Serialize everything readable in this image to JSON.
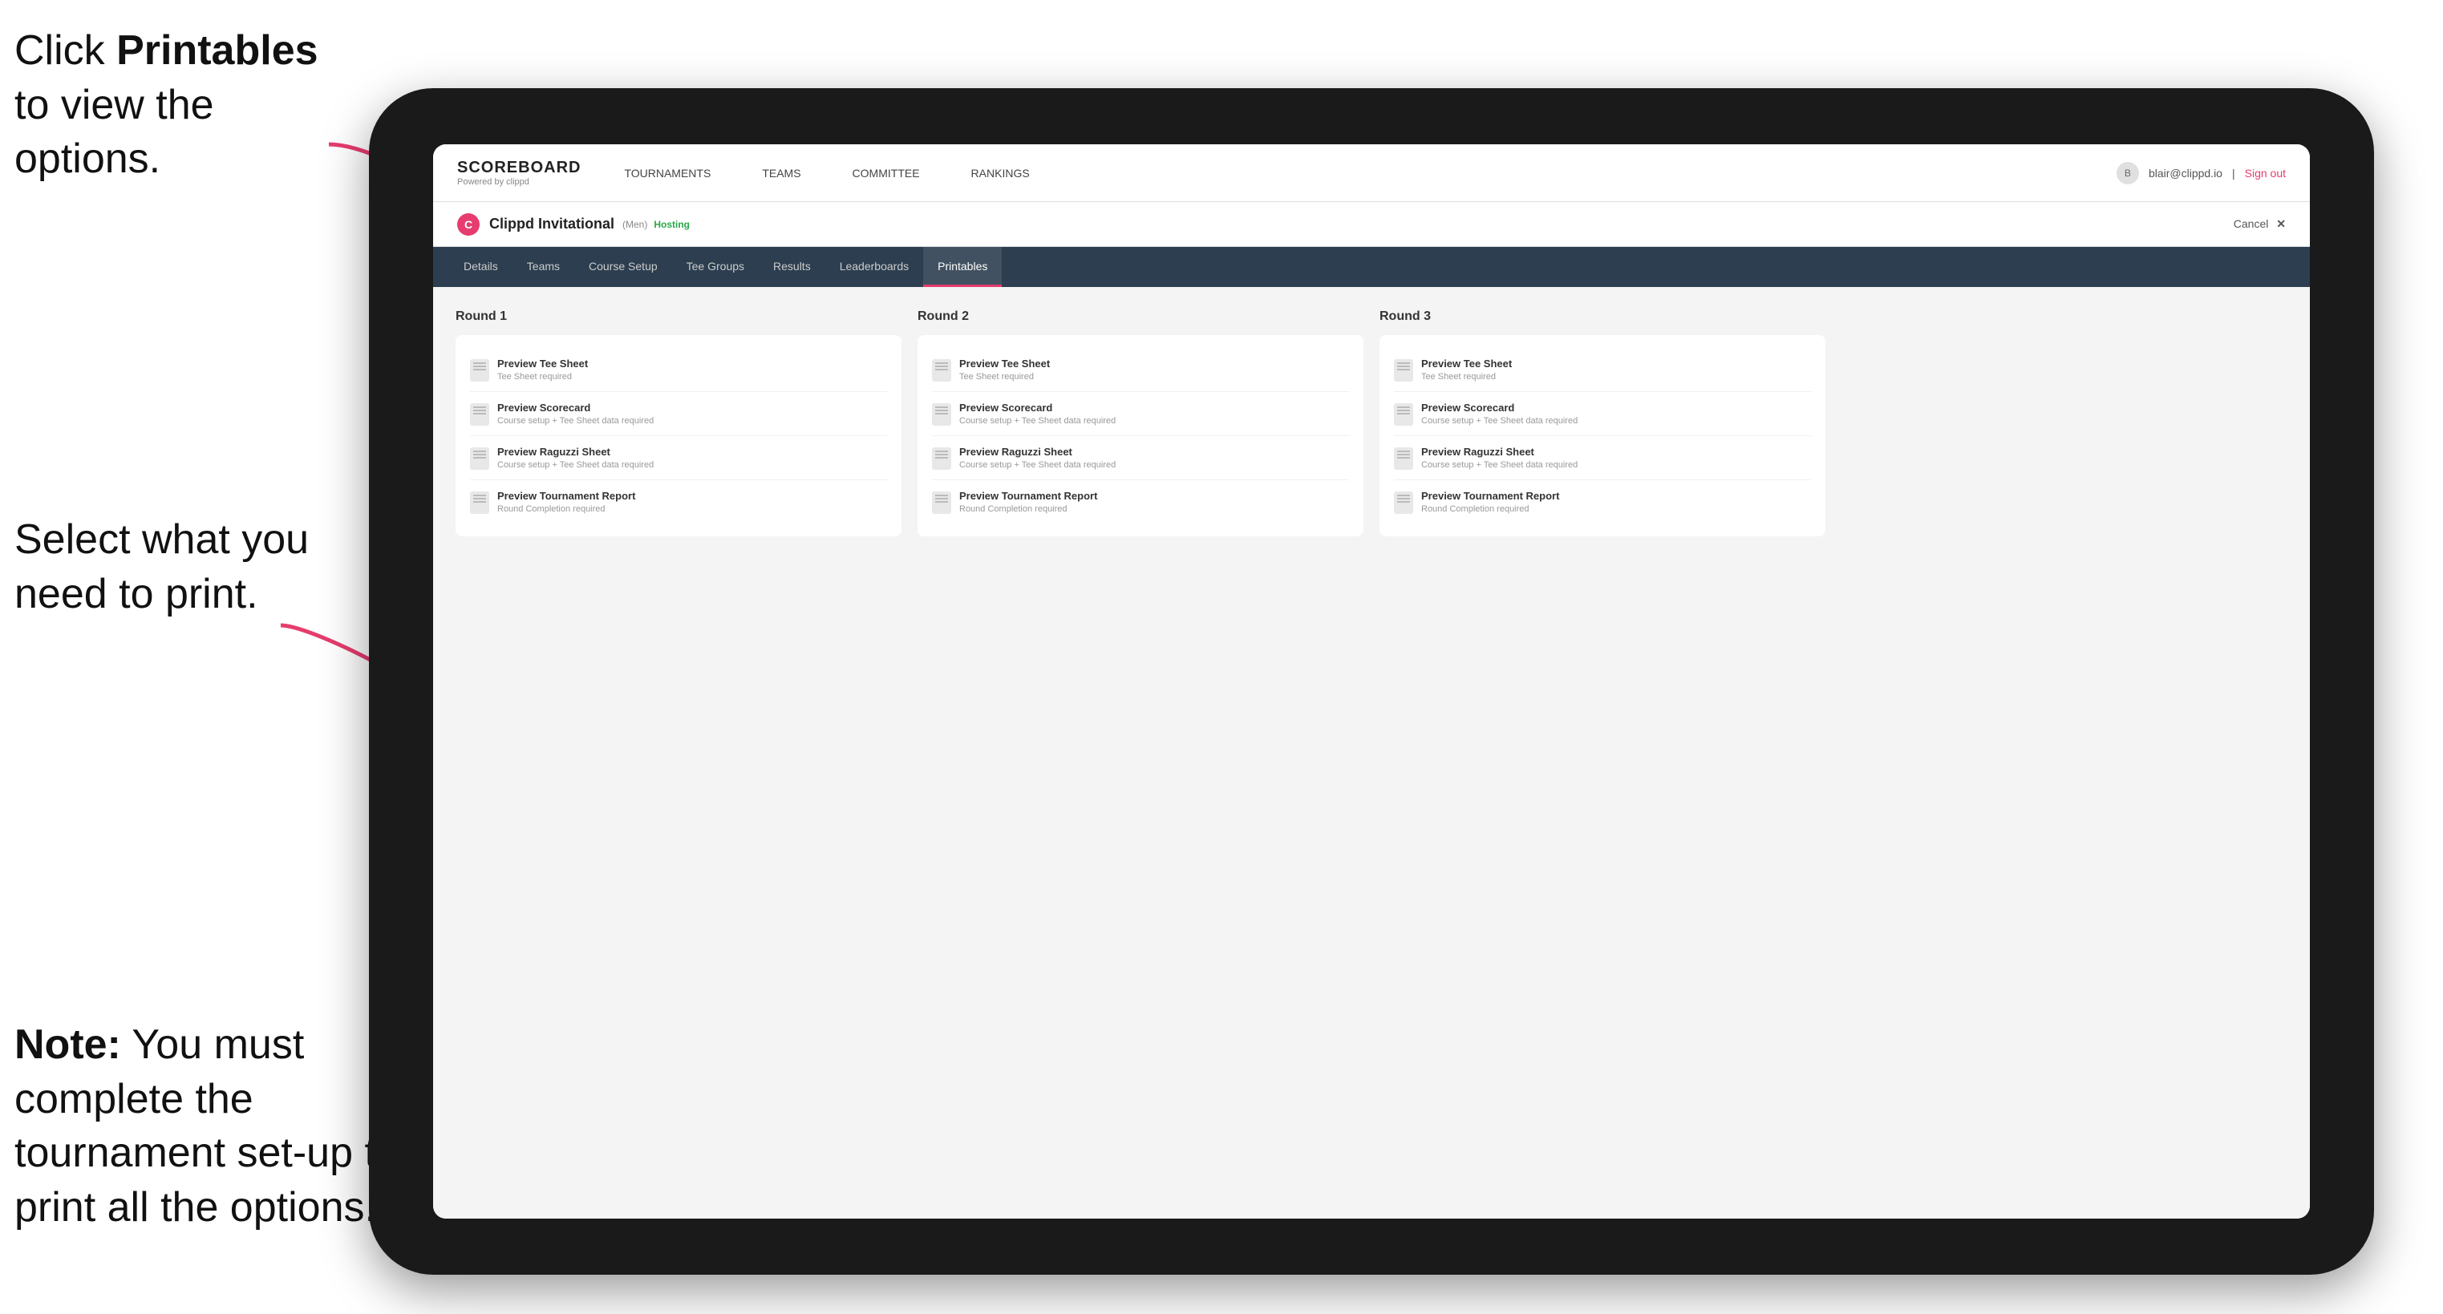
{
  "annotations": {
    "text1_part1": "Click ",
    "text1_bold": "Printables",
    "text1_part2": " to view the options.",
    "text2_line1": "Select what you",
    "text2_line2": "need to print.",
    "text3_note": "Note:",
    "text3_rest": " You must complete the tournament set-up to print all the options."
  },
  "topNav": {
    "logoTitle": "SCOREBOARD",
    "logoPowered": "Powered by clippd",
    "links": [
      {
        "label": "TOURNAMENTS",
        "active": false
      },
      {
        "label": "TEAMS",
        "active": false
      },
      {
        "label": "COMMITTEE",
        "active": false
      },
      {
        "label": "RANKINGS",
        "active": false
      }
    ],
    "userEmail": "blair@clippd.io",
    "signOut": "Sign out"
  },
  "tournamentHeader": {
    "logoLetter": "C",
    "name": "Clippd Invitational",
    "tag": "(Men)",
    "status": "Hosting",
    "cancelLabel": "Cancel"
  },
  "subNav": {
    "links": [
      {
        "label": "Details",
        "active": false
      },
      {
        "label": "Teams",
        "active": false
      },
      {
        "label": "Course Setup",
        "active": false
      },
      {
        "label": "Tee Groups",
        "active": false
      },
      {
        "label": "Results",
        "active": false
      },
      {
        "label": "Leaderboards",
        "active": false
      },
      {
        "label": "Printables",
        "active": true
      }
    ]
  },
  "rounds": [
    {
      "title": "Round 1",
      "items": [
        {
          "name": "Preview Tee Sheet",
          "req": "Tee Sheet required"
        },
        {
          "name": "Preview Scorecard",
          "req": "Course setup + Tee Sheet data required"
        },
        {
          "name": "Preview Raguzzi Sheet",
          "req": "Course setup + Tee Sheet data required"
        },
        {
          "name": "Preview Tournament Report",
          "req": "Round Completion required"
        }
      ]
    },
    {
      "title": "Round 2",
      "items": [
        {
          "name": "Preview Tee Sheet",
          "req": "Tee Sheet required"
        },
        {
          "name": "Preview Scorecard",
          "req": "Course setup + Tee Sheet data required"
        },
        {
          "name": "Preview Raguzzi Sheet",
          "req": "Course setup + Tee Sheet data required"
        },
        {
          "name": "Preview Tournament Report",
          "req": "Round Completion required"
        }
      ]
    },
    {
      "title": "Round 3",
      "items": [
        {
          "name": "Preview Tee Sheet",
          "req": "Tee Sheet required"
        },
        {
          "name": "Preview Scorecard",
          "req": "Course setup + Tee Sheet data required"
        },
        {
          "name": "Preview Raguzzi Sheet",
          "req": "Course setup + Tee Sheet data required"
        },
        {
          "name": "Preview Tournament Report",
          "req": "Round Completion required"
        }
      ]
    }
  ]
}
